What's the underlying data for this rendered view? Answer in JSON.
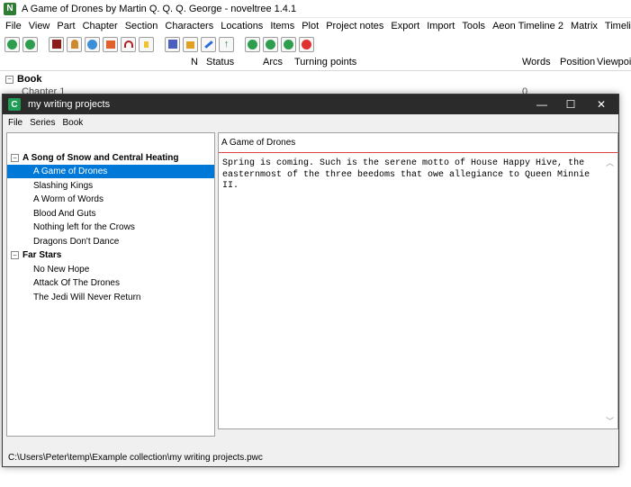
{
  "background_app": {
    "title": "A Game of Drones by Martin Q. Q. Q. George - noveltree 1.4.1",
    "menu": [
      "File",
      "View",
      "Part",
      "Chapter",
      "Section",
      "Characters",
      "Locations",
      "Items",
      "Plot",
      "Project notes",
      "Export",
      "Import",
      "Tools",
      "Aeon Timeline 2",
      "Matrix",
      "Timeline"
    ],
    "columns": {
      "n": "N",
      "status": "Status",
      "arcs": "Arcs",
      "turning_points": "Turning points",
      "words": "Words",
      "position": "Position",
      "viewpoint": "Viewpoint"
    },
    "tree_root": "Book",
    "partial_row_label": "Chapter 1",
    "partial_row_value": "0",
    "toolbar_icons": [
      "back-icon",
      "forward-icon",
      "book-icon",
      "character-icon",
      "location-icon",
      "item-icon",
      "arc-icon",
      "note-icon",
      "save-icon",
      "lock-icon",
      "edit-icon",
      "upload-icon",
      "add-icon",
      "add-child-icon",
      "add-parent-icon",
      "remove-icon"
    ],
    "colors": {
      "accent_green": "#2e7d32"
    }
  },
  "window": {
    "title": "my writing projects",
    "menu": [
      "File",
      "Series",
      "Book"
    ],
    "tree": {
      "series": [
        {
          "name": "A Song of Snow and Central Heating",
          "books": [
            "A Game of Drones",
            "Slashing Kings",
            "A Worm of Words",
            "Blood And Guts",
            "Nothing left for the Crows",
            "Dragons Don't Dance"
          ]
        },
        {
          "name": "Far Stars",
          "books": [
            "No New Hope",
            "Attack Of The Drones",
            "The Jedi Will Never Return"
          ]
        }
      ],
      "selected": "A Game of Drones",
      "expander_symbol": "⊟"
    },
    "editor": {
      "heading": "A Game of Drones",
      "text": "Spring is coming. Such is the serene motto of House Happy Hive, the easternmost of the three beedoms that owe allegiance to Queen Minnie II."
    },
    "status_path": "C:\\Users\\Peter\\temp\\Example collection\\my writing projects.pwc",
    "controls": {
      "minimize": "—",
      "maximize": "☐",
      "close": "✕"
    },
    "colors": {
      "selection": "#0078d7",
      "heading_rule": "#e04040",
      "titlebar": "#2b2b2b",
      "icon": "#1e9e55"
    }
  }
}
